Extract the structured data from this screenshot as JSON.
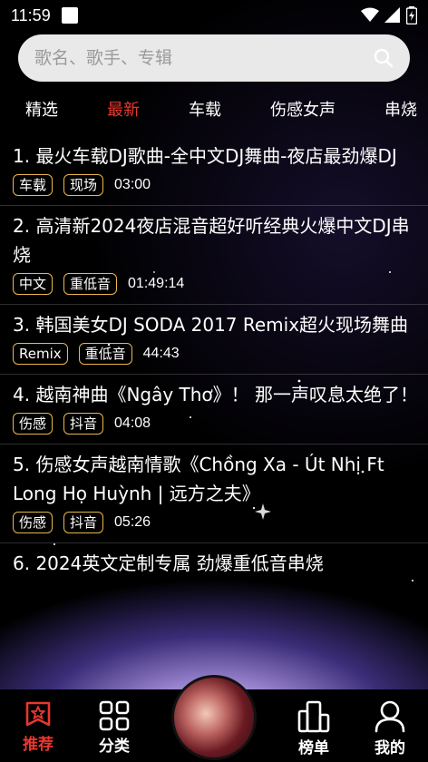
{
  "status_bar": {
    "time": "11:59"
  },
  "search": {
    "placeholder": "歌名、歌手、专辑"
  },
  "tabs": [
    {
      "label": "精选",
      "active": false
    },
    {
      "label": "最新",
      "active": true
    },
    {
      "label": "车载",
      "active": false
    },
    {
      "label": "伤感女声",
      "active": false
    },
    {
      "label": "串烧",
      "active": false
    }
  ],
  "songs": [
    {
      "title": "1. 最火车载DJ歌曲-全中文DJ舞曲-夜店最劲爆DJ",
      "tags": [
        "车载",
        "现场"
      ],
      "duration": "03:00"
    },
    {
      "title": "2. 高清新2024夜店混音超好听经典火爆中文DJ串烧",
      "tags": [
        "中文",
        "重低音"
      ],
      "duration": "01:49:14"
    },
    {
      "title": "3. 韩国美女DJ SODA 2017 Remix超火现场舞曲",
      "tags": [
        "Remix",
        "重低音"
      ],
      "duration": "44:43"
    },
    {
      "title": "4. 越南神曲《Ngây Thơ》！ 那一声叹息太绝了！",
      "tags": [
        "伤感",
        "抖音"
      ],
      "duration": "04:08"
    },
    {
      "title": "5. 伤感女声越南情歌《Chồng Xa - Út Nhị Ft Long Họ Huỳnh | 远方之夫》",
      "tags": [
        "伤感",
        "抖音"
      ],
      "duration": "05:26"
    },
    {
      "title": "6. 2024英文定制专属 劲爆重低音串烧",
      "tags": [],
      "duration": ""
    }
  ],
  "bottom_nav": {
    "items": [
      {
        "label": "推荐",
        "icon": "star-badge-icon",
        "active": true
      },
      {
        "label": "分类",
        "icon": "grid-icon",
        "active": false
      },
      {
        "label": "榜单",
        "icon": "bar-chart-icon",
        "active": false
      },
      {
        "label": "我的",
        "icon": "user-icon",
        "active": false
      }
    ]
  },
  "colors": {
    "accent": "#e8372f",
    "tag_border": "#e8b84a"
  }
}
